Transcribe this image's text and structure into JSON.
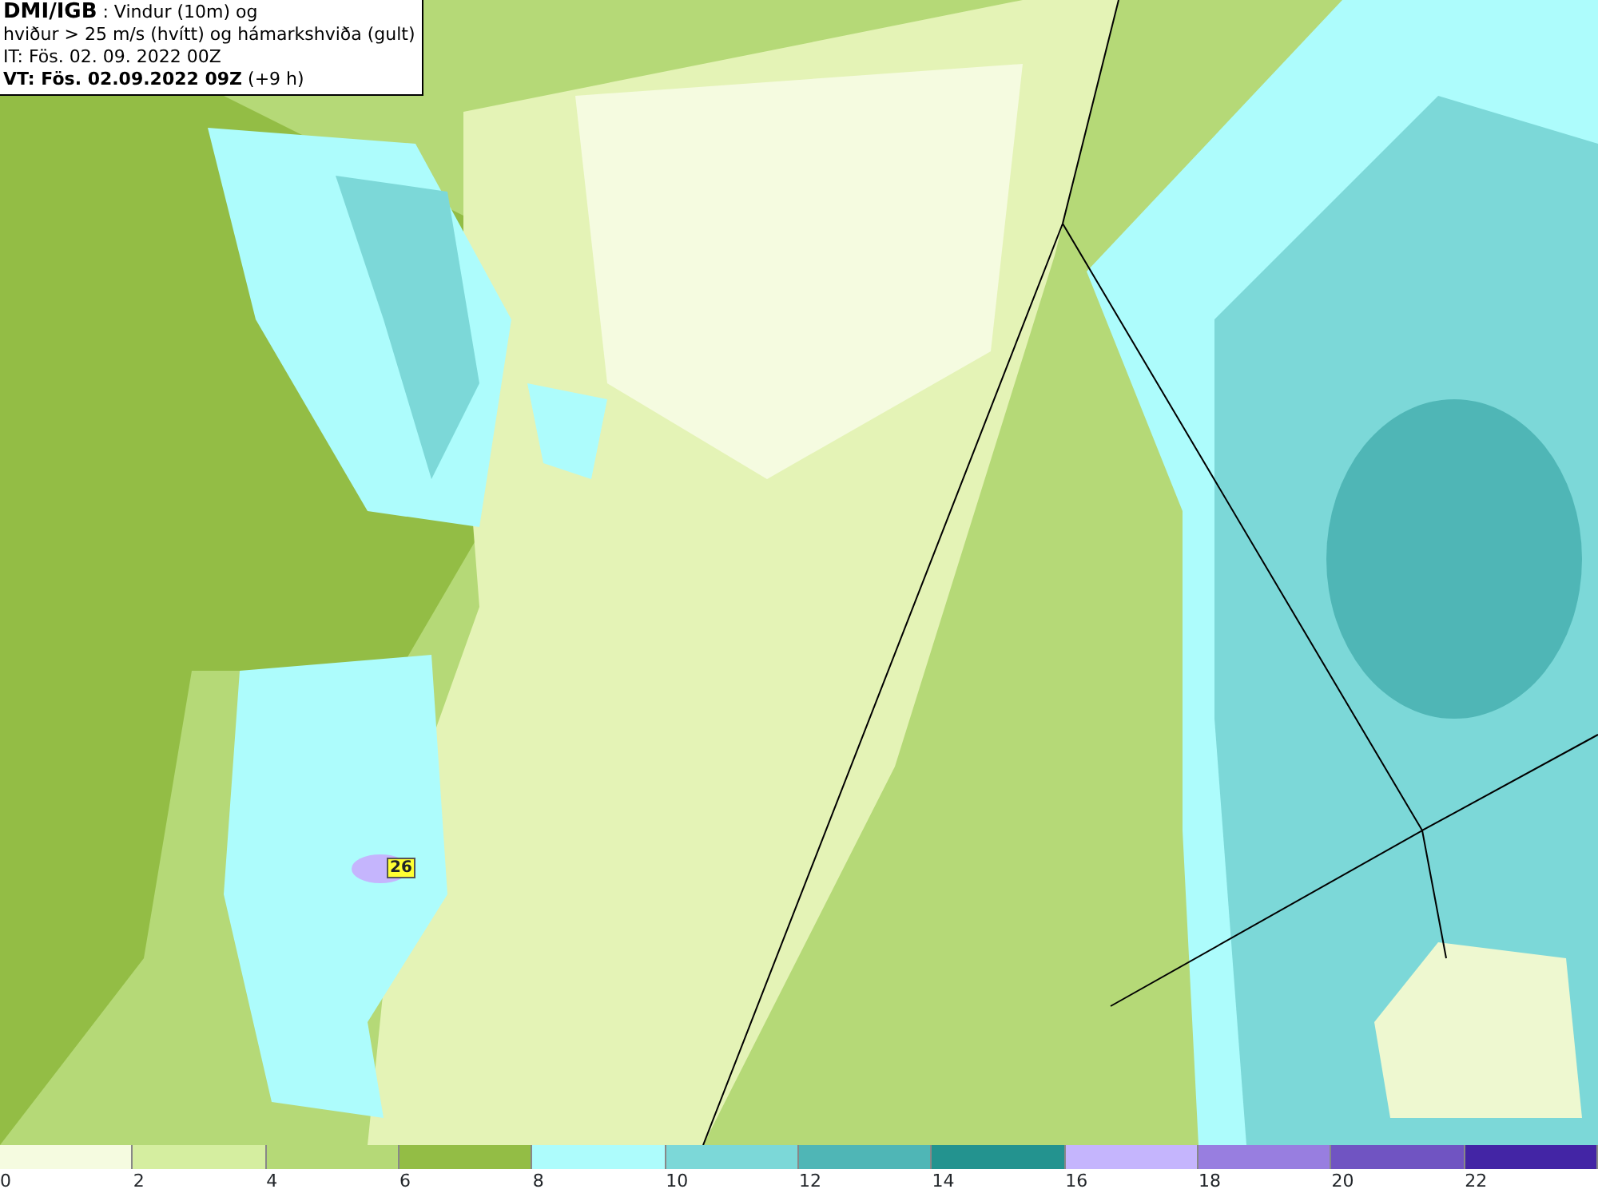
{
  "title_box": {
    "lines": [
      {
        "text": "**DMI/IGB** : Vindur (10m) og"
      },
      {
        "text": "hviður > 25 m/s (hvítt) og hámarkshviða (gult)"
      },
      {
        "text": "IT: Fös. 02. 09. 2022 00Z"
      },
      {
        "text": "**VT: Fös. 02.09.2022 09Z** (+9 h)"
      }
    ]
  },
  "map": {
    "gust_label": "26"
  },
  "legend": {
    "bins": [
      {
        "color": "#f5fbe0",
        "label": "0"
      },
      {
        "color": "#d5eea0",
        "label": "2"
      },
      {
        "color": "#b5d977",
        "label": "4"
      },
      {
        "color": "#93bd45",
        "label": "6"
      },
      {
        "color": "#adfcfc",
        "label": "8"
      },
      {
        "color": "#7cd8d8",
        "label": "10"
      },
      {
        "color": "#4fb6b6",
        "label": "12"
      },
      {
        "color": "#23938f",
        "label": "14"
      },
      {
        "color": "#c5b5fd",
        "label": "16"
      },
      {
        "color": "#987ee0",
        "label": "18"
      },
      {
        "color": "#7054c2",
        "label": "20"
      },
      {
        "color": "#4325a5",
        "label": "22"
      }
    ]
  }
}
